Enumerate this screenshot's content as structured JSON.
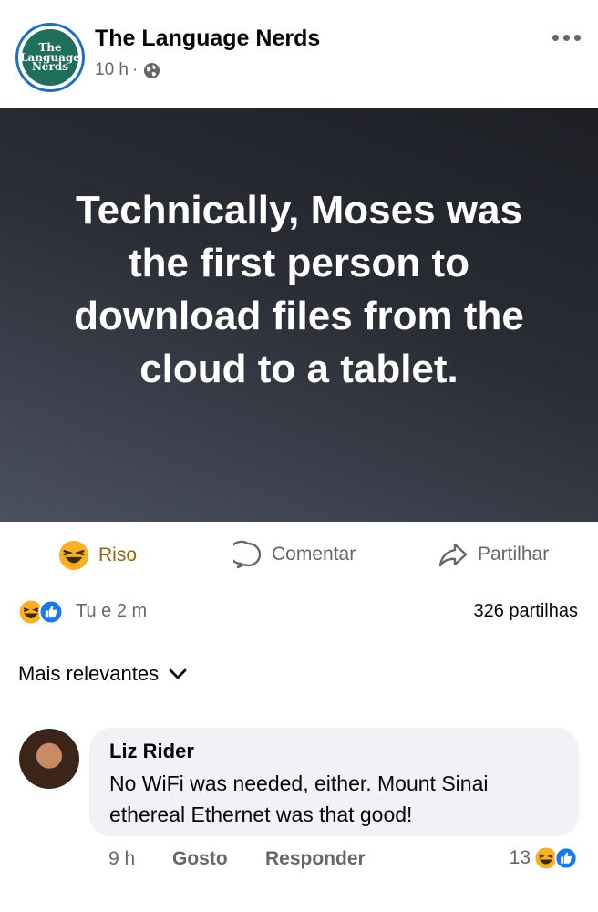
{
  "post": {
    "page_name": "The Language Nerds",
    "avatar_text": [
      "The",
      "Language",
      "Nerds"
    ],
    "time": "10 h",
    "separator": "·",
    "audience_icon": "globe-icon",
    "more_icon": "more-options-icon",
    "image_text": "Technically, Moses was the first person to download files from the cloud to a tablet."
  },
  "actions": {
    "reaction_label": "Riso",
    "comment_label": "Comentar",
    "share_label": "Partilhar"
  },
  "stats": {
    "reactions_text": "Tu e 2 m",
    "shares_text": "326 partilhas",
    "reaction_icons": [
      "laugh-emoji-icon",
      "like-icon"
    ]
  },
  "comments": {
    "sort_label": "Mais relevantes",
    "items": [
      {
        "author": "Liz Rider",
        "text": "No WiFi was needed, either. Mount Sinai ethereal Ethernet  was that good!",
        "time": "9 h",
        "like_label": "Gosto",
        "reply_label": "Responder",
        "reaction_count": "13"
      }
    ]
  },
  "colors": {
    "accent_blue": "#1877f2",
    "text_primary": "#050505",
    "text_secondary": "#65676b",
    "bubble_bg": "#f0f2f5",
    "laugh_yellow": "#f7b125"
  }
}
